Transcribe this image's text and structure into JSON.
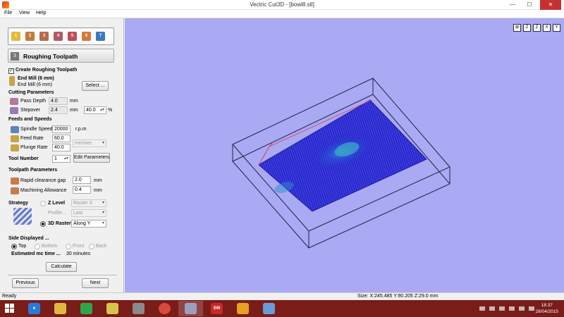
{
  "window": {
    "title": "Vectric Cut3D - [bowl8.stl]",
    "min": "—",
    "max": "☐",
    "close": "✕"
  },
  "menu": [
    "File",
    "View",
    "Help"
  ],
  "wizard": {
    "steps": [
      "1",
      "2",
      "3",
      "4",
      "5",
      "6",
      "7"
    ]
  },
  "section": {
    "number": "3",
    "title": "Roughing Toolpath"
  },
  "create": {
    "label": "Create Roughing Toolpath",
    "checked": true
  },
  "tool": {
    "name": "End Mill (6 mm)",
    "sub": "End Mill (6 mm)",
    "select_label": "Select ..."
  },
  "cutting": {
    "heading": "Cutting Parameters",
    "pass_depth_label": "Pass Depth",
    "pass_depth": "4.0",
    "pass_unit": "mm",
    "stepover_label": "Stepover",
    "stepover": "2.4",
    "stepover_unit": "mm",
    "stepover_pct": "40.0",
    "pct_sign": "%"
  },
  "feeds": {
    "heading": "Feeds and Speeds",
    "spindle_label": "Spindle Speed",
    "spindle": "20000",
    "spindle_unit": "r.p.m",
    "feed_label": "Feed Rate",
    "feed": "60.0",
    "plunge_label": "Plunge Rate",
    "plunge": "40.0",
    "rate_unit": "mm/sec",
    "tool_number_label": "Tool Number",
    "tool_number": "1",
    "edit_params": "Edit Parameters"
  },
  "toolpath": {
    "heading": "Toolpath Parameters",
    "clearance_label": "Rapid clearance gap",
    "clearance": "2.0",
    "clearance_unit": "mm",
    "allowance_label": "Machining Allowance",
    "allowance": "0.4",
    "allowance_unit": "mm"
  },
  "strategy": {
    "heading": "Strategy",
    "z_level_label": "Z Level",
    "z_level_value": "Raster X",
    "profile_label": "Profile...",
    "profile_value": "Last",
    "raster_label": "3D Raster",
    "raster_value": "Along Y",
    "selected": "3D Raster"
  },
  "side": {
    "heading": "Side Displayed ...",
    "options": [
      "Top",
      "Bottom",
      "Front",
      "Back"
    ],
    "selected": "Top",
    "estimate_label": "Estimated mc time ...",
    "estimate_value": "30 minutes"
  },
  "calculate_label": "Calculate",
  "previous_label": "Previous",
  "next_label": "Next",
  "view_icons": [
    "⊞",
    "Z",
    "Z",
    "X",
    "Y"
  ],
  "status": {
    "left": "Ready",
    "size": "Size: X:245.485 Y:90.205 Z:29.0 mm"
  },
  "taskbar": {
    "time": "18:37",
    "date": "28/04/2015"
  },
  "colors": {
    "viewport": "#a9a9f4",
    "toolpath": "#1a1ac8",
    "bbox": "#222244",
    "taskbar": "#7a1c18"
  }
}
